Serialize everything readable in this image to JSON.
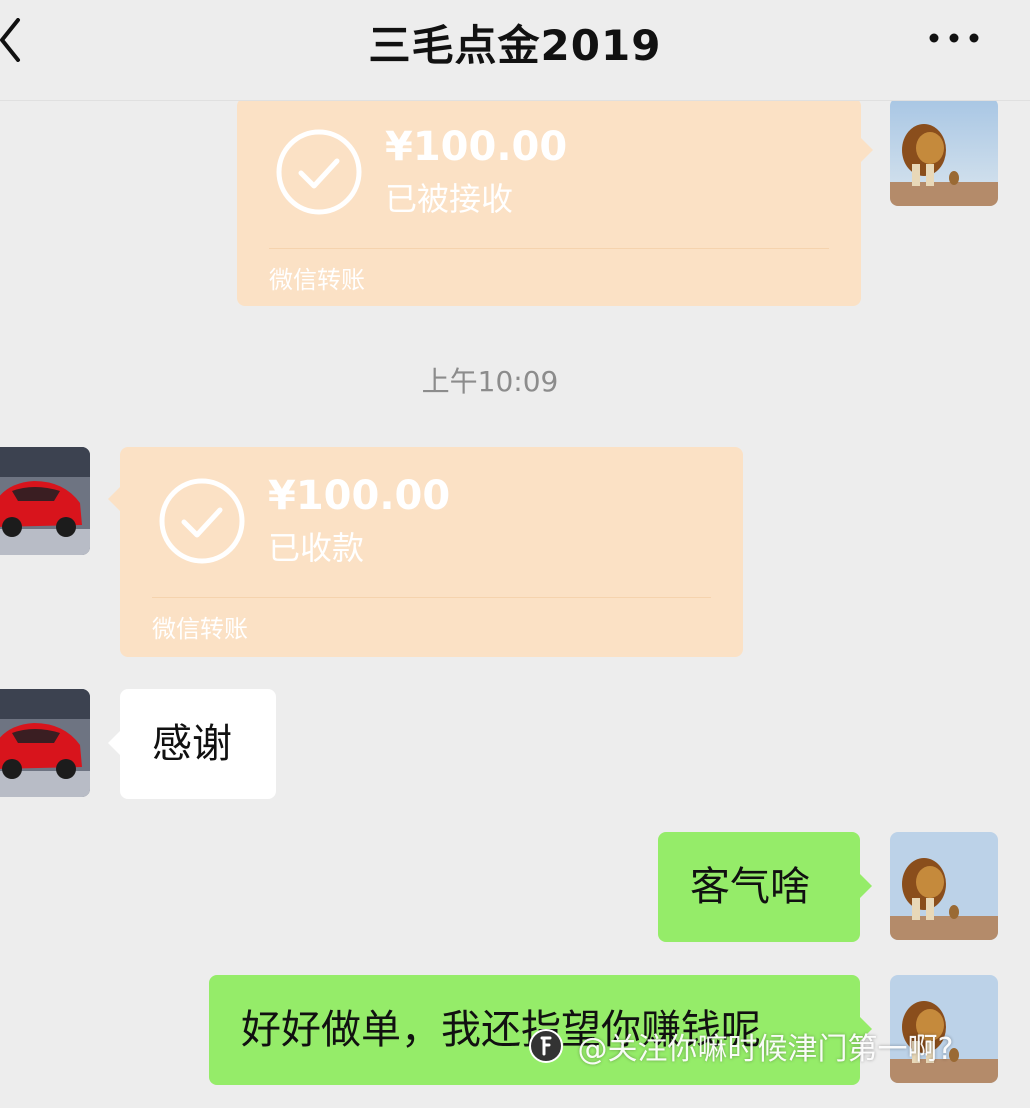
{
  "header": {
    "title": "三毛点金2019"
  },
  "messages": {
    "transfer_sent": {
      "amount": "¥100.00",
      "status": "已被接收",
      "footer": "微信转账"
    },
    "timestamp": "上午10:09",
    "transfer_received": {
      "amount": "¥100.00",
      "status": "已收款",
      "footer": "微信转账"
    },
    "reply_thanks": "感谢",
    "my_reply_1": "客气啥",
    "my_reply_2": "好好做单，我还指望你赚钱呢"
  },
  "watermark": {
    "text": "@关注你嘛时候津门第一啊?"
  },
  "colors": {
    "background": "#ededed",
    "transfer_card": "#fbe1c5",
    "green_bubble": "#95ec69",
    "white_bubble": "#ffffff"
  },
  "icons": {
    "back": "chevron-left-icon",
    "more": "ellipsis-icon",
    "transfer_check": "check-circle-icon"
  }
}
